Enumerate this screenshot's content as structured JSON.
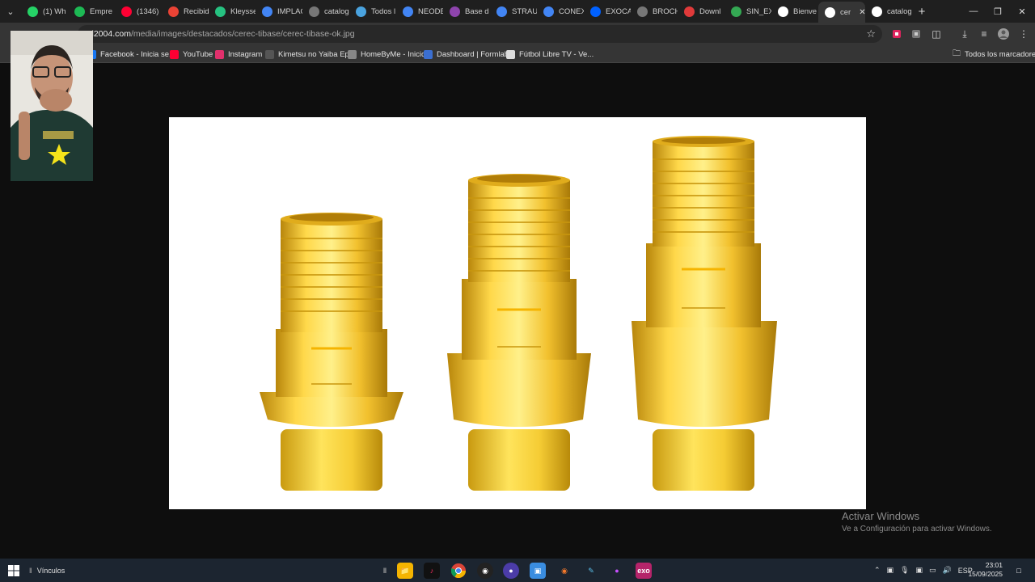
{
  "browser": {
    "tabs": [
      {
        "label": "(1) Wh",
        "icon": "whatsapp-icon",
        "color": "#25d366"
      },
      {
        "label": "Empre",
        "icon": "gear-green-icon",
        "color": "#1db954"
      },
      {
        "label": "(1346)",
        "icon": "youtube-icon",
        "color": "#ff0033"
      },
      {
        "label": "Recibid",
        "icon": "gmail-icon",
        "color": "#ea4335"
      },
      {
        "label": "Kleysse",
        "icon": "k-icon",
        "color": "#26c281"
      },
      {
        "label": "IMPLAC",
        "icon": "google-icon",
        "color": "#4285f4"
      },
      {
        "label": "catalog",
        "icon": "globe-icon",
        "color": "#777777"
      },
      {
        "label": "Todos l",
        "icon": "site-icon",
        "color": "#4aa3df"
      },
      {
        "label": "NEODE",
        "icon": "google-icon",
        "color": "#4285f4"
      },
      {
        "label": "Base d",
        "icon": "site-icon",
        "color": "#8e44ad"
      },
      {
        "label": "STRAU",
        "icon": "google-icon",
        "color": "#4285f4"
      },
      {
        "label": "CONEX",
        "icon": "google-icon",
        "color": "#4285f4"
      },
      {
        "label": "EXOCA",
        "icon": "dropbox-icon",
        "color": "#0061ff"
      },
      {
        "label": "BROCH",
        "icon": "globe-icon",
        "color": "#777777"
      },
      {
        "label": "Downl",
        "icon": "site-icon",
        "color": "#e03a3a"
      },
      {
        "label": "SIN_EX",
        "icon": "drive-icon",
        "color": "#34a853"
      },
      {
        "label": "Bienve",
        "icon": "site-icon",
        "color": "#ffffff"
      },
      {
        "label": "cer",
        "icon": "site-icon",
        "color": "#ffffff",
        "active": true
      },
      {
        "label": "catalog",
        "icon": "site-icon",
        "color": "#ffffff"
      }
    ],
    "new_tab": "+",
    "url_host": "d2004.com",
    "url_path": "/media/images/destacados/cerec-tibase/cerec-tibase-ok.jpg",
    "bookmarks": [
      {
        "label": "Facebook - Inicia se...",
        "icon": "facebook-icon",
        "color": "#1877f2"
      },
      {
        "label": "YouTube",
        "icon": "youtube-icon",
        "color": "#ff0033"
      },
      {
        "label": "Instagram",
        "icon": "instagram-icon",
        "color": "#e1306c"
      },
      {
        "label": "Kimetsu no Yaiba Ep...",
        "icon": "site-icon",
        "color": "#555555"
      },
      {
        "label": "HomeByMe - Inicio",
        "icon": "home-icon",
        "color": "#888888"
      },
      {
        "label": "Dashboard | Formlabs",
        "icon": "formlabs-icon",
        "color": "#3b6fd1"
      },
      {
        "label": "Fútbol Libre TV - Ve...",
        "icon": "ball-icon",
        "color": "#dddddd"
      }
    ],
    "all_bookmarks": "Todos los marcadores"
  },
  "watermark": {
    "title": "Activar Windows",
    "subtitle": "Ve a Configuración para activar Windows."
  },
  "taskbar": {
    "links_label": "Vínculos",
    "language": "ESP",
    "time": "23:01",
    "date": "15/09/2025"
  }
}
